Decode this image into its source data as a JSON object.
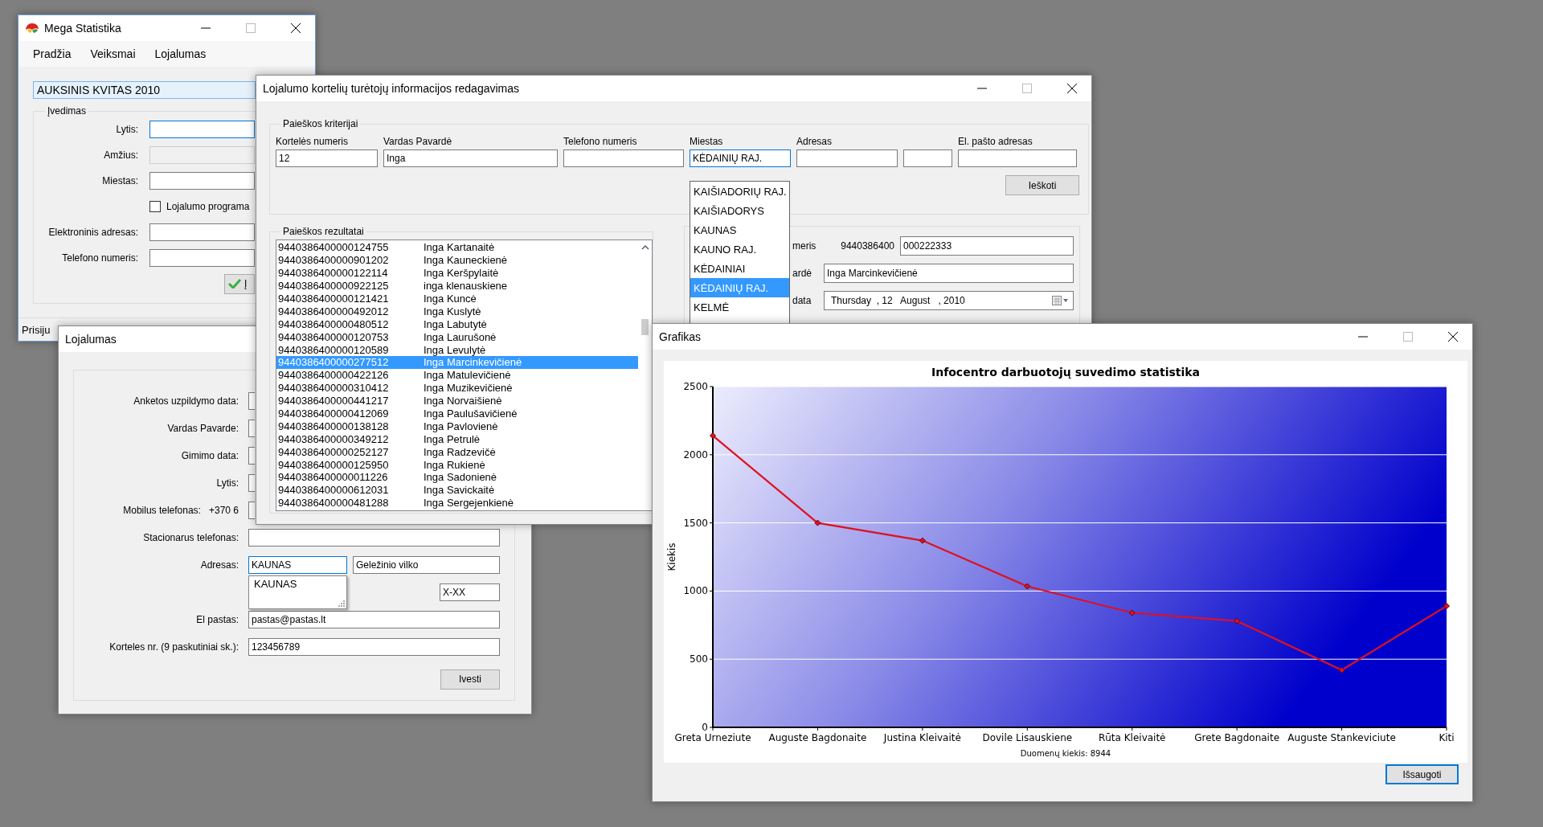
{
  "main_window": {
    "title": "Mega Statistika",
    "menu": [
      "Pradžia",
      "Veiksmai",
      "Lojalumas"
    ],
    "banner": "AUKSINIS KVITAS 2010",
    "group": "Įvedimas",
    "fields": [
      {
        "kind": "field",
        "label": "Lytis:",
        "focused": true,
        "disabled": false
      },
      {
        "kind": "field",
        "label": "Amžius:",
        "focused": false,
        "disabled": true
      },
      {
        "kind": "field",
        "label": "Miestas:",
        "focused": false,
        "disabled": false
      },
      {
        "kind": "checkbox",
        "label": "Lojalumo programa",
        "checked": false
      },
      {
        "kind": "field",
        "label": "Elektroninis adresas:",
        "focused": false,
        "disabled": false
      },
      {
        "kind": "field",
        "label": "Telefono numeris:",
        "focused": false,
        "disabled": false
      }
    ],
    "button": "Į",
    "status": "Prisiju"
  },
  "form_window": {
    "title": "Lojalumas",
    "rows": [
      {
        "label": "Anketos uzpildymo data:",
        "fields": [
          {
            "kind": "stub"
          }
        ]
      },
      {
        "label": "Vardas Pavarde:",
        "fields": [
          {
            "kind": "stub"
          }
        ]
      },
      {
        "label": "Gimimo data:",
        "fields": [
          {
            "kind": "stub"
          }
        ]
      },
      {
        "label": "Lytis:",
        "fields": [
          {
            "kind": "stub"
          }
        ]
      },
      {
        "label": "Mobilus telefonas:",
        "prefix": "+370 6",
        "fields": [
          {
            "kind": "stub"
          }
        ]
      },
      {
        "label": "Stacionarus telefonas:",
        "fields": [
          {
            "kind": "wide"
          }
        ]
      },
      {
        "label": "Adresas:",
        "fields": [
          {
            "kind": "city",
            "value": "KAUNAS",
            "focused": true,
            "suggestion": "KAUNAS"
          },
          {
            "kind": "street",
            "value": "Geležinio vilko"
          }
        ]
      },
      {
        "fields": [
          {
            "kind": "house",
            "value": "X-XX"
          }
        ]
      },
      {
        "label": "El pastas:",
        "fields": [
          {
            "kind": "wide",
            "value": "pastas@pastas.lt",
            "focused": false
          }
        ]
      },
      {
        "label": "Korteles nr. (9 paskutiniai sk.):",
        "fields": [
          {
            "kind": "wide",
            "value": "123456789"
          }
        ]
      }
    ],
    "button": "Ivesti"
  },
  "search_window": {
    "title": "Lojalumo kortelių turėtojų informacijos redagavimas",
    "criteria_group": "Paieškos kriterijai",
    "criteria": [
      {
        "label": "Kortelės numeris",
        "value": "12",
        "focused": false
      },
      {
        "label": "Vardas Pavardė",
        "value": "Inga",
        "focused": false
      },
      {
        "label": "Telefono numeris",
        "focused": false
      },
      {
        "label": "Miestas",
        "value": "KĖDAINIŲ RAJ.",
        "focused": true
      },
      {
        "label": "Adresas",
        "focused": false
      },
      {
        "focused": false
      },
      {
        "label": "El. pašto adresas",
        "focused": false
      }
    ],
    "search_button": "Ieškoti",
    "city_options": [
      {
        "label": "KAIŠIADORIŲ RAJ.",
        "selected": false
      },
      {
        "label": "KAIŠIADORYS",
        "selected": false
      },
      {
        "label": "KAUNAS",
        "selected": false
      },
      {
        "label": "KAUNO RAJ.",
        "selected": false
      },
      {
        "label": "KĖDAINIAI",
        "selected": false
      },
      {
        "label": "KĖDAINIŲ RAJ.",
        "selected": true
      },
      {
        "label": "KELMĖ",
        "selected": false
      }
    ],
    "results_group": "Paieškos rezultatai",
    "results": [
      {
        "card": "9440386400000124755",
        "name": "Inga Kartanaitė",
        "selected": false
      },
      {
        "card": "9440386400000901202",
        "name": "Inga Kauneckienė",
        "selected": false
      },
      {
        "card": "9440386400000122114",
        "name": "Inga Keršpylaitė",
        "selected": false
      },
      {
        "card": "9440386400000922125",
        "name": "inga klenauskiene",
        "selected": false
      },
      {
        "card": "9440386400000121421",
        "name": "Inga Kuncė",
        "selected": false
      },
      {
        "card": "9440386400000492012",
        "name": "Inga Kuslytė",
        "selected": false
      },
      {
        "card": "9440386400000480512",
        "name": "Inga Labutytė",
        "selected": false
      },
      {
        "card": "9440386400000120753",
        "name": "Inga Laurušonė",
        "selected": false
      },
      {
        "card": "9440386400000120589",
        "name": "Inga Levulytė",
        "selected": false
      },
      {
        "card": "9440386400000277512",
        "name": "Inga Marcinkevičienė",
        "selected": true
      },
      {
        "card": "9440386400000422126",
        "name": "Inga Matulevičienė",
        "selected": false
      },
      {
        "card": "9440386400000310412",
        "name": "Inga Muzikevičienė",
        "selected": false
      },
      {
        "card": "9440386400000441217",
        "name": "Inga Norvaišienė",
        "selected": false
      },
      {
        "card": "9440386400000412069",
        "name": "Inga Paulušavičienė",
        "selected": false
      },
      {
        "card": "9440386400000138128",
        "name": "Inga Pavlovienė",
        "selected": false
      },
      {
        "card": "9440386400000349212",
        "name": "Inga Petrulė",
        "selected": false
      },
      {
        "card": "9440386400000252127",
        "name": "Inga Radzevičė",
        "selected": false
      },
      {
        "card": "9440386400000125950",
        "name": "Inga Rukienė",
        "selected": false
      },
      {
        "card": "9440386400000011226",
        "name": "Inga Sadonienė",
        "selected": false
      },
      {
        "card": "9440386400000612031",
        "name": "Inga Savickaitė",
        "selected": false
      },
      {
        "card": "9440386400000481288",
        "name": "Inga Sergejenkienė",
        "selected": false
      }
    ],
    "details": [
      {
        "kind": "field",
        "label": "meris",
        "prefix": "9440386400",
        "value": "000222333"
      },
      {
        "kind": "field",
        "label": "ardė",
        "value": "Inga Marcinkevičienė"
      },
      {
        "kind": "date",
        "label": "data",
        "value": "Thursday  , 12   August   , 2010"
      }
    ]
  },
  "chart_window": {
    "title": "Grafikas",
    "save_button": "Išsaugoti",
    "chart_data": {
      "type": "line",
      "title": "Infocentro darbuotojų suvedimo statistika",
      "xlabel": "Duomenų kiekis: 8944",
      "ylabel": "Kiekis",
      "categories": [
        "Greta Urneziute",
        "Auguste Bagdonaite",
        "Justina Kleivaitė",
        "Dovile Lisauskiene",
        "Rūta Kleivaitė",
        "Grete Bagdonaite",
        "Auguste Stankeviciute",
        "Kiti"
      ],
      "grid": true,
      "series": [
        {
          "color": "#e01020",
          "marker": "diamond",
          "values": [
            2140,
            1500,
            1370,
            1035,
            840,
            780,
            420,
            890
          ]
        }
      ],
      "ylim": [
        0,
        2500
      ],
      "yticks": [
        0,
        500,
        1000,
        1500,
        2000,
        2500
      ]
    }
  }
}
